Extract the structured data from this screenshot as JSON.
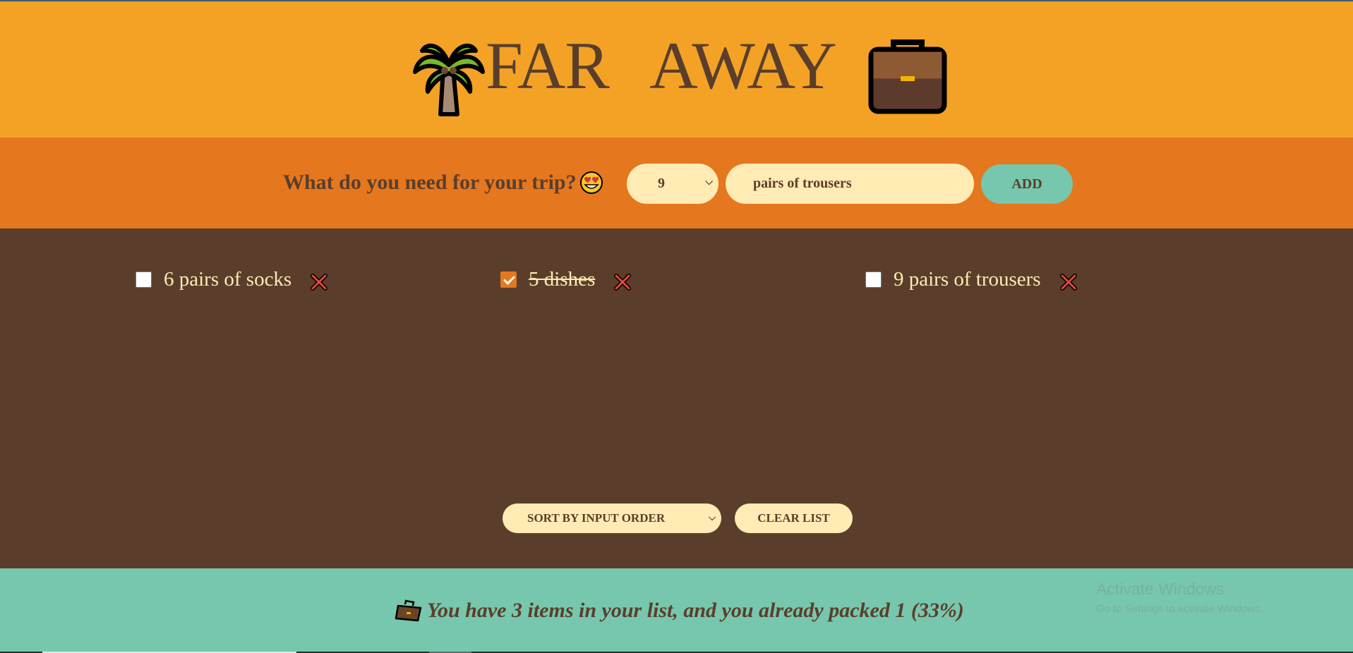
{
  "header": {
    "title": "FAR  AWAY",
    "left_icon": "palm-tree-icon",
    "right_icon": "briefcase-icon"
  },
  "form": {
    "question": "What do you need for your trip?",
    "question_emoji": "heart-eyes-emoji-icon",
    "quantity_value": "9",
    "description_value": "pairs of trousers",
    "add_label": "ADD"
  },
  "items": [
    {
      "label": "6 pairs of socks",
      "packed": false
    },
    {
      "label": "5 dishes",
      "packed": true
    },
    {
      "label": "9 pairs of trousers",
      "packed": false
    }
  ],
  "actions": {
    "sort_value": "SORT BY INPUT ORDER",
    "clear_label": "CLEAR LIST"
  },
  "stats": {
    "icon": "briefcase-icon",
    "text": "You have 3 items in your list, and you already packed 1 (33%)"
  },
  "watermark": {
    "title": "Activate Windows",
    "subtitle": "Go to Settings to activate Windows."
  },
  "colors": {
    "header_bg": "#f4a226",
    "form_bg": "#e5771f",
    "list_bg": "#5a3e2b",
    "stats_bg": "#76c7ad",
    "cream": "#ffebb3",
    "brown": "#5a3e2b"
  }
}
